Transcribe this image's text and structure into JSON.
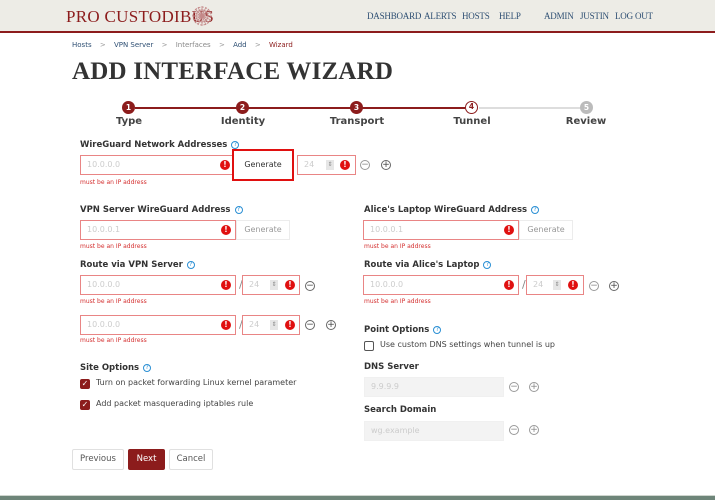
{
  "header": {
    "brand": "PRO CUSTODIBUS",
    "nav": [
      "DASHBOARD",
      "ALERTS",
      "HOSTS",
      "HELP"
    ],
    "user_nav": [
      "ADMIN",
      "JUSTIN",
      "LOG OUT"
    ]
  },
  "breadcrumb": [
    "Hosts",
    "VPN Server",
    "Interfaces",
    "Add",
    "Wizard"
  ],
  "breadcrumb_sep": ">",
  "page_title": "ADD INTERFACE WIZARD",
  "wizard": {
    "steps": [
      {
        "number": "1",
        "label": "Type",
        "state": "complete"
      },
      {
        "number": "2",
        "label": "Identity",
        "state": "complete"
      },
      {
        "number": "3",
        "label": "Transport",
        "state": "complete"
      },
      {
        "number": "4",
        "label": "Tunnel",
        "state": "current"
      },
      {
        "number": "5",
        "label": "Review",
        "state": "pending"
      }
    ],
    "colors": {
      "complete": "#8c1c1c",
      "pending": "#bbbbbb",
      "line_pending": "#dddddd"
    }
  },
  "form": {
    "network_addresses": {
      "label": "WireGuard Network Addresses",
      "address_placeholder": "10.0.0.0",
      "prefix_placeholder": "24",
      "generate_label": "Generate",
      "error": "must be an IP address"
    },
    "server_address": {
      "label": "VPN Server WireGuard Address",
      "placeholder": "10.0.0.1",
      "generate_label": "Generate",
      "error": "must be an IP address"
    },
    "point_address": {
      "label": "Alice's Laptop WireGuard Address",
      "placeholder": "10.0.0.1",
      "generate_label": "Generate",
      "error": "must be an IP address"
    },
    "route_server": {
      "label": "Route via VPN Server",
      "rows": [
        {
          "address_placeholder": "10.0.0.0",
          "prefix_placeholder": "24",
          "error": "must be an IP address"
        },
        {
          "address_placeholder": "10.0.0.0",
          "prefix_placeholder": "24",
          "error": "must be an IP address"
        }
      ]
    },
    "route_point": {
      "label": "Route via Alice's Laptop",
      "rows": [
        {
          "address_placeholder": "10.0.0.0",
          "prefix_placeholder": "24",
          "error": "must be an IP address"
        }
      ]
    },
    "site_options": {
      "label": "Site Options",
      "options": [
        {
          "label": "Turn on packet forwarding Linux kernel parameter",
          "checked": true
        },
        {
          "label": "Add packet masquerading iptables rule",
          "checked": true
        }
      ]
    },
    "point_options": {
      "label": "Point Options",
      "options": [
        {
          "label": "Use custom DNS settings when tunnel is up",
          "checked": false
        }
      ]
    },
    "dns_server": {
      "label": "DNS Server",
      "placeholder": "9.9.9.9"
    },
    "search_domain": {
      "label": "Search Domain",
      "placeholder": "wg.example"
    }
  },
  "icons": {
    "error": "!",
    "help": "?",
    "remove": "−",
    "add": "+",
    "check": "✓",
    "spinner": "⇕"
  },
  "buttons": {
    "previous": "Previous",
    "next": "Next",
    "cancel": "Cancel"
  }
}
